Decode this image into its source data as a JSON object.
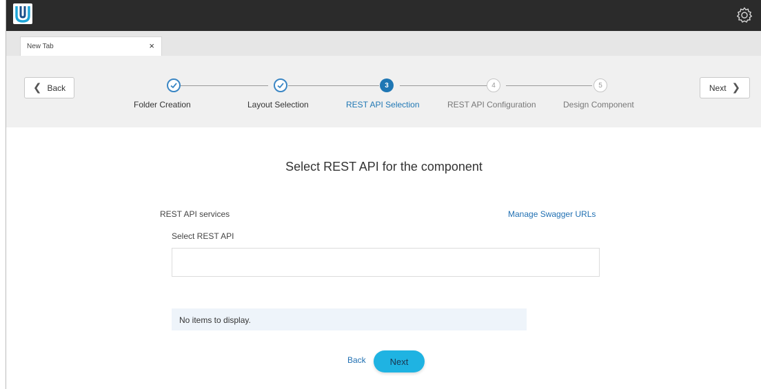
{
  "colors": {
    "topbar": "#2b2b2b",
    "accent": "#1f77b4",
    "link": "#1f6fb2",
    "primary_button": "#1fb3e2",
    "empty_row": "#eef4fa"
  },
  "topbar": {
    "logo_icon": "u-logo-icon",
    "settings_icon": "gear-icon"
  },
  "tab": {
    "label": "New Tab",
    "close": "×"
  },
  "wizard": {
    "back_label": "Back",
    "next_label": "Next",
    "steps": [
      {
        "number": "1",
        "label": "Folder Creation",
        "state": "done"
      },
      {
        "number": "2",
        "label": "Layout Selection",
        "state": "done"
      },
      {
        "number": "3",
        "label": "REST API Selection",
        "state": "active"
      },
      {
        "number": "4",
        "label": "REST API Configuration",
        "state": "pending"
      },
      {
        "number": "5",
        "label": "Design Component",
        "state": "pending"
      }
    ]
  },
  "main": {
    "title": "Select REST API for the component",
    "services_label": "REST API services",
    "manage_link": "Manage Swagger URLs",
    "select_label": "Select REST API",
    "select_value": "",
    "empty_message": "No items to display.",
    "back_label": "Back",
    "next_label": "Next"
  }
}
